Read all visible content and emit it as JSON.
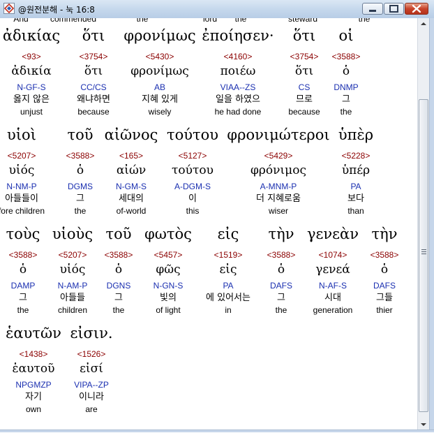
{
  "window": {
    "title": "@원전분해 - 눅 16:8",
    "minimize_icon": "minimize-icon",
    "maximize_icon": "maximize-icon",
    "close_icon": "close-icon"
  },
  "previous_row": [
    "And",
    "commended",
    "the",
    "lord",
    "the",
    "steward",
    "the"
  ],
  "rows": [
    [
      {
        "greek": "ἀδικίας",
        "strong": "<93>",
        "lemma": "ἀδικία",
        "morph": "N-GF-S",
        "korean": "옳지 않은",
        "english": "unjust"
      },
      {
        "greek": "ὅτι",
        "strong": "<3754>",
        "lemma": "ὅτι",
        "morph": "CC/CS",
        "korean": "왜냐하면",
        "english": "because"
      },
      {
        "greek": "φρονίμως",
        "strong": "<5430>",
        "lemma": "φρονίμως",
        "morph": "AB",
        "korean": "지혜 있게",
        "english": "wisely"
      },
      {
        "greek": "ἐποίησεν·",
        "strong": "<4160>",
        "lemma": "ποιέω",
        "morph": "VIAA--ZS",
        "korean": "일을 하였으",
        "english": "he had done"
      },
      {
        "greek": "ὅτι",
        "strong": "<3754>",
        "lemma": "ὅτι",
        "morph": "CS",
        "korean": "므로",
        "english": "because"
      },
      {
        "greek": "οἱ",
        "strong": "<3588>",
        "lemma": "ὁ",
        "morph": "DNMP",
        "korean": "그",
        "english": "the"
      }
    ],
    [
      {
        "greek": "υἱοὶ",
        "strong": "<5207>",
        "lemma": "υἱός",
        "morph": "N-NM-P",
        "korean": "아들들이",
        "english": "fore children"
      },
      {
        "greek": "τοῦ",
        "strong": "<3588>",
        "lemma": "ὁ",
        "morph": "DGMS",
        "korean": "그",
        "english": "the"
      },
      {
        "greek": "αἰῶνος",
        "strong": "<165>",
        "lemma": "αἰών",
        "morph": "N-GM-S",
        "korean": "세대의",
        "english": "of-world"
      },
      {
        "greek": "τούτου",
        "strong": "<5127>",
        "lemma": "τούτου",
        "morph": "A-DGM-S",
        "korean": "이",
        "english": "this"
      },
      {
        "greek": "φρονιμώτεροι",
        "strong": "<5429>",
        "lemma": "φρόνιμος",
        "morph": "A-MNM-P",
        "korean": "더 지혜로움",
        "english": "wiser"
      },
      {
        "greek": "ὑπὲρ",
        "strong": "<5228>",
        "lemma": "ὑπέρ",
        "morph": "PA",
        "korean": "보다",
        "english": "than"
      }
    ],
    [
      {
        "greek": "τοὺς",
        "strong": "<3588>",
        "lemma": "ὁ",
        "morph": "DAMP",
        "korean": "그",
        "english": "the"
      },
      {
        "greek": "υἱοὺς",
        "strong": "<5207>",
        "lemma": "υἱός",
        "morph": "N-AM-P",
        "korean": "아들들",
        "english": "children"
      },
      {
        "greek": "τοῦ",
        "strong": "<3588>",
        "lemma": "ὁ",
        "morph": "DGNS",
        "korean": "그",
        "english": "the"
      },
      {
        "greek": "φωτὸς",
        "strong": "<5457>",
        "lemma": "φῶς",
        "morph": "N-GN-S",
        "korean": "빛의",
        "english": "of light"
      },
      {
        "greek": "εἰς",
        "strong": "<1519>",
        "lemma": "εἰς",
        "morph": "PA",
        "korean": "에 있어서는",
        "english": "in"
      },
      {
        "greek": "τὴν",
        "strong": "<3588>",
        "lemma": "ὁ",
        "morph": "DAFS",
        "korean": "그",
        "english": "the"
      },
      {
        "greek": "γενεὰν",
        "strong": "<1074>",
        "lemma": "γενεά",
        "morph": "N-AF-S",
        "korean": "시대",
        "english": "generation"
      },
      {
        "greek": "τὴν",
        "strong": "<3588>",
        "lemma": "ὁ",
        "morph": "DAFS",
        "korean": "그들",
        "english": "thier"
      }
    ],
    [
      {
        "greek": "ἑαυτῶν",
        "strong": "<1438>",
        "lemma": "ἑαυτοῦ",
        "morph": "NPGMZP",
        "korean": "자기",
        "english": "own"
      },
      {
        "greek": "εἰσιν.",
        "strong": "<1526>",
        "lemma": "εἰσί",
        "morph": "VIPA--ZP",
        "korean": "이니라",
        "english": "are"
      }
    ]
  ]
}
